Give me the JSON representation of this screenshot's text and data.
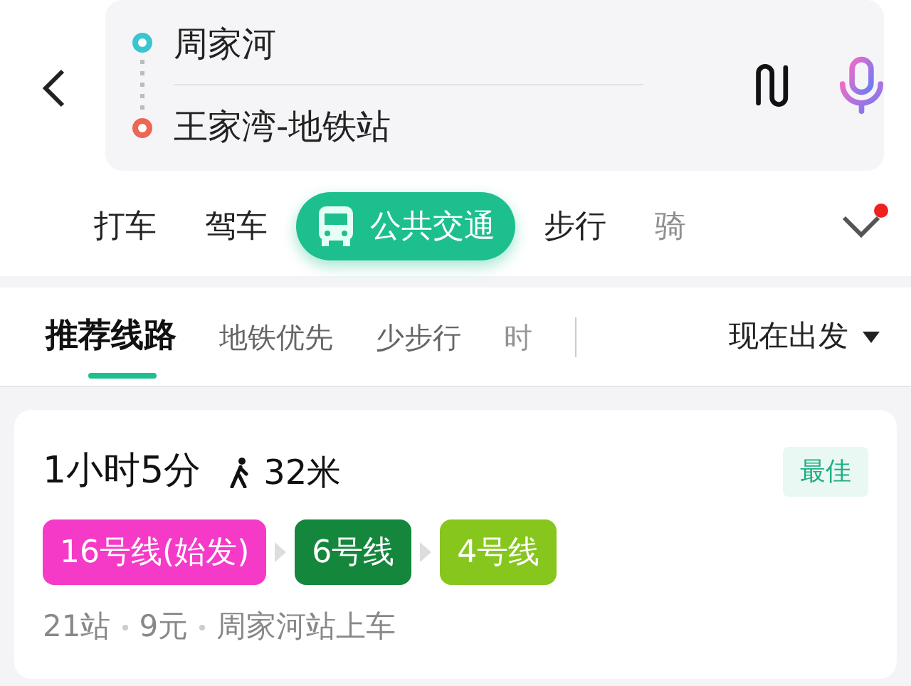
{
  "search": {
    "from": "周家河",
    "to": "王家湾-地铁站"
  },
  "mode_tabs": [
    {
      "label": "打车",
      "selected": false
    },
    {
      "label": "驾车",
      "selected": false
    },
    {
      "label": "公共交通",
      "selected": true
    },
    {
      "label": "步行",
      "selected": false
    },
    {
      "label": "骑",
      "selected": false
    }
  ],
  "more_badge": true,
  "route_filters": [
    {
      "label": "推荐线路",
      "selected": true
    },
    {
      "label": "地铁优先",
      "selected": false
    },
    {
      "label": "少步行",
      "selected": false
    },
    {
      "label": "时",
      "selected": false
    }
  ],
  "depart": "现在出发",
  "routes": [
    {
      "duration": "1小时5分",
      "walk": "32米",
      "tag": "最佳",
      "lines": [
        {
          "name": "16号线(始发)",
          "color": "#f53ac8"
        },
        {
          "name": "6号线",
          "color": "#14873c"
        },
        {
          "name": "4号线",
          "color": "#86c61d"
        }
      ],
      "info": [
        "21站",
        "9元",
        "周家河站上车"
      ]
    }
  ]
}
